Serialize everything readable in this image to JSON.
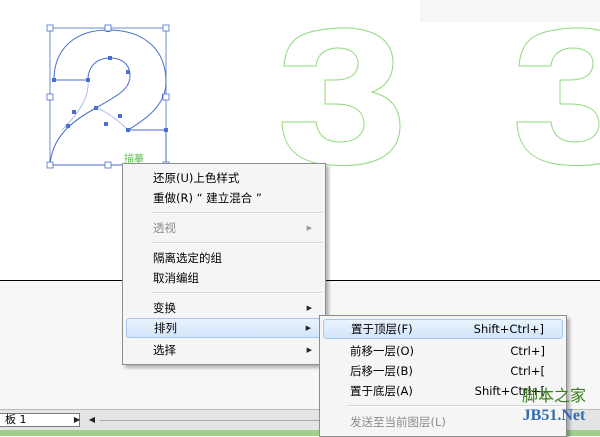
{
  "canvas": {
    "selection_tooltip": "描摹",
    "colors": {
      "path_blue": "#4a6fcf",
      "outline_green": "#8fd97a"
    }
  },
  "context_menu": {
    "items": [
      {
        "label": "还原(U)上色样式",
        "enabled": true
      },
      {
        "label": "重做(R) “ 建立混合 ”",
        "enabled": true
      },
      {
        "label": "透视",
        "enabled": false,
        "submenu": true
      },
      {
        "label": "隔离选定的组",
        "enabled": true
      },
      {
        "label": "取消编组",
        "enabled": true
      },
      {
        "label": "变换",
        "enabled": true,
        "submenu": true
      },
      {
        "label": "排列",
        "enabled": true,
        "submenu": true,
        "highlighted": true
      },
      {
        "label": "选择",
        "enabled": true,
        "submenu": true
      }
    ]
  },
  "arrange_submenu": {
    "items": [
      {
        "label": "置于顶层(F)",
        "shortcut": "Shift+Ctrl+]",
        "enabled": true,
        "highlighted": true
      },
      {
        "label": "前移一层(O)",
        "shortcut": "Ctrl+]",
        "enabled": true
      },
      {
        "label": "后移一层(B)",
        "shortcut": "Ctrl+[",
        "enabled": true
      },
      {
        "label": "置于底层(A)",
        "shortcut": "Shift+Ctrl+[",
        "enabled": true
      },
      {
        "label": "发送至当前图层(L)",
        "shortcut": "",
        "enabled": false
      }
    ]
  },
  "status_bar": {
    "page_value": "1",
    "page_prefix": "板"
  },
  "watermark": {
    "top": "脚本之家",
    "bottom": "JB51.Net"
  }
}
